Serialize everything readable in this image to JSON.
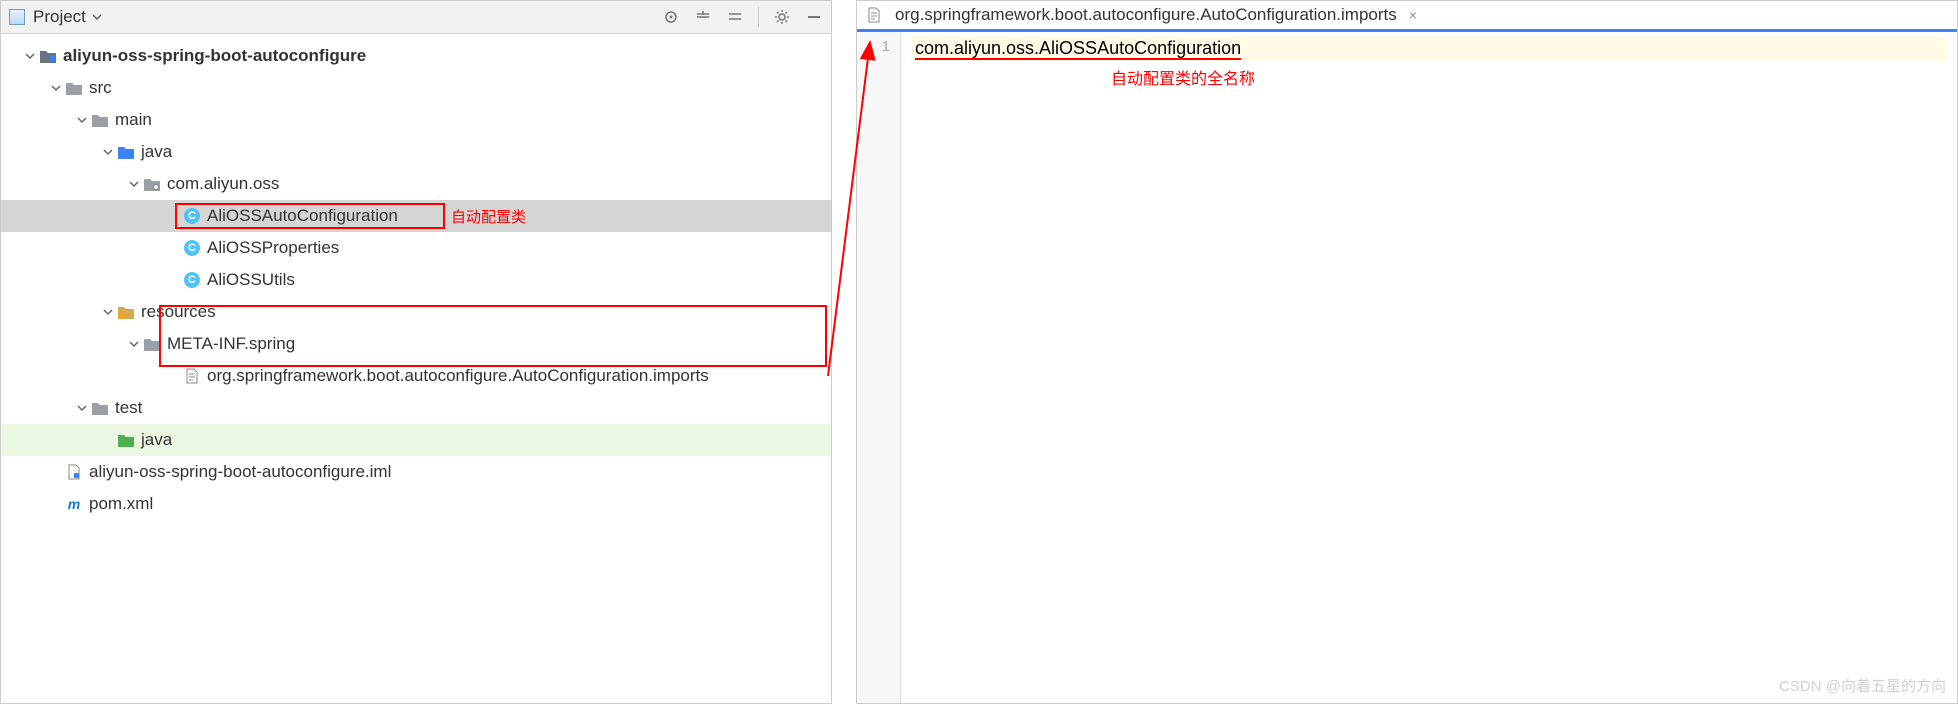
{
  "panel": {
    "title": "Project"
  },
  "tree": {
    "root": "aliyun-oss-spring-boot-autoconfigure",
    "src": "src",
    "main": "main",
    "java": "java",
    "pkg": "com.aliyun.oss",
    "class1": "AliOSSAutoConfiguration",
    "class2": "AliOSSProperties",
    "class3": "AliOSSUtils",
    "resources": "resources",
    "metainf": "META-INF.spring",
    "importsFile": "org.springframework.boot.autoconfigure.AutoConfiguration.imports",
    "test": "test",
    "testJava": "java",
    "iml": "aliyun-oss-spring-boot-autoconfigure.iml",
    "pom": "pom.xml"
  },
  "annotations": {
    "autoConfigClass": "自动配置类",
    "fullClassName": "自动配置类的全名称"
  },
  "editor": {
    "tabTitle": "org.springframework.boot.autoconfigure.AutoConfiguration.imports",
    "lineNumber": "1",
    "codeLine": "com.aliyun.oss.AliOSSAutoConfiguration"
  },
  "watermark": "CSDN @向着五星的方向"
}
